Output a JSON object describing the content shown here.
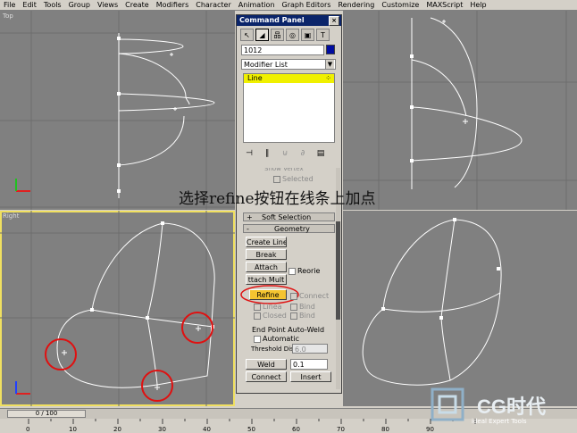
{
  "menubar": [
    "File",
    "Edit",
    "Tools",
    "Group",
    "Views",
    "Create",
    "Modifiers",
    "Character",
    "Animation",
    "Graph Editors",
    "Rendering",
    "Customize",
    "MAXScript",
    "Help"
  ],
  "viewports": {
    "top": "Top",
    "left": "Right"
  },
  "panel": {
    "title": "Command Panel",
    "close": "×",
    "tabs": [
      "↖",
      "◢",
      "品",
      "◎",
      "▣",
      "T"
    ],
    "object_name": "1012",
    "object_color": "#000ca0",
    "modifier_list": "Modifier List",
    "stack_item": "Line",
    "stack_icon": "⁘",
    "stack_tools": [
      "⊣",
      "∥",
      "⊍",
      "∂",
      "▤"
    ],
    "selection_rollout_partial": "Show Vertex",
    "selected_label": "Selected",
    "soft_selection": {
      "sign": "+",
      "label": "Soft Selection"
    },
    "geometry": {
      "sign": "-",
      "label": "Geometry"
    },
    "create_line": "Create Line",
    "break": "Break",
    "attach": "Attach",
    "reorient": "Reorie",
    "attach_mult": "ttach Mult",
    "refine": "Refine",
    "connect_chk": "Connect",
    "linear": "Linea",
    "bind1": "Bind",
    "closed": "Closed",
    "bind2": "Bind",
    "endpoint_title": "End Point Auto-Weld",
    "automatic": "Automatic",
    "threshold_label": "Threshold Dist",
    "threshold_value": "6.0",
    "weld": "Weld",
    "weld_value": "0.1",
    "connect": "Connect",
    "insert": "Insert"
  },
  "timeline": {
    "frame": "0 / 100",
    "ticks": [
      "0",
      "10",
      "20",
      "30",
      "40",
      "50",
      "60",
      "70",
      "80",
      "90"
    ]
  },
  "annotation": "选择refine按钮在线条上加点",
  "logo": {
    "text": "CG时代",
    "sub": "ideal Expert Tools"
  },
  "colors": {
    "viewport_bg": "#808080",
    "spline": "#ffffff",
    "highlight_circle": "#e01010",
    "active_viewport": "#f0e060",
    "titlebar": "#0a246a"
  }
}
